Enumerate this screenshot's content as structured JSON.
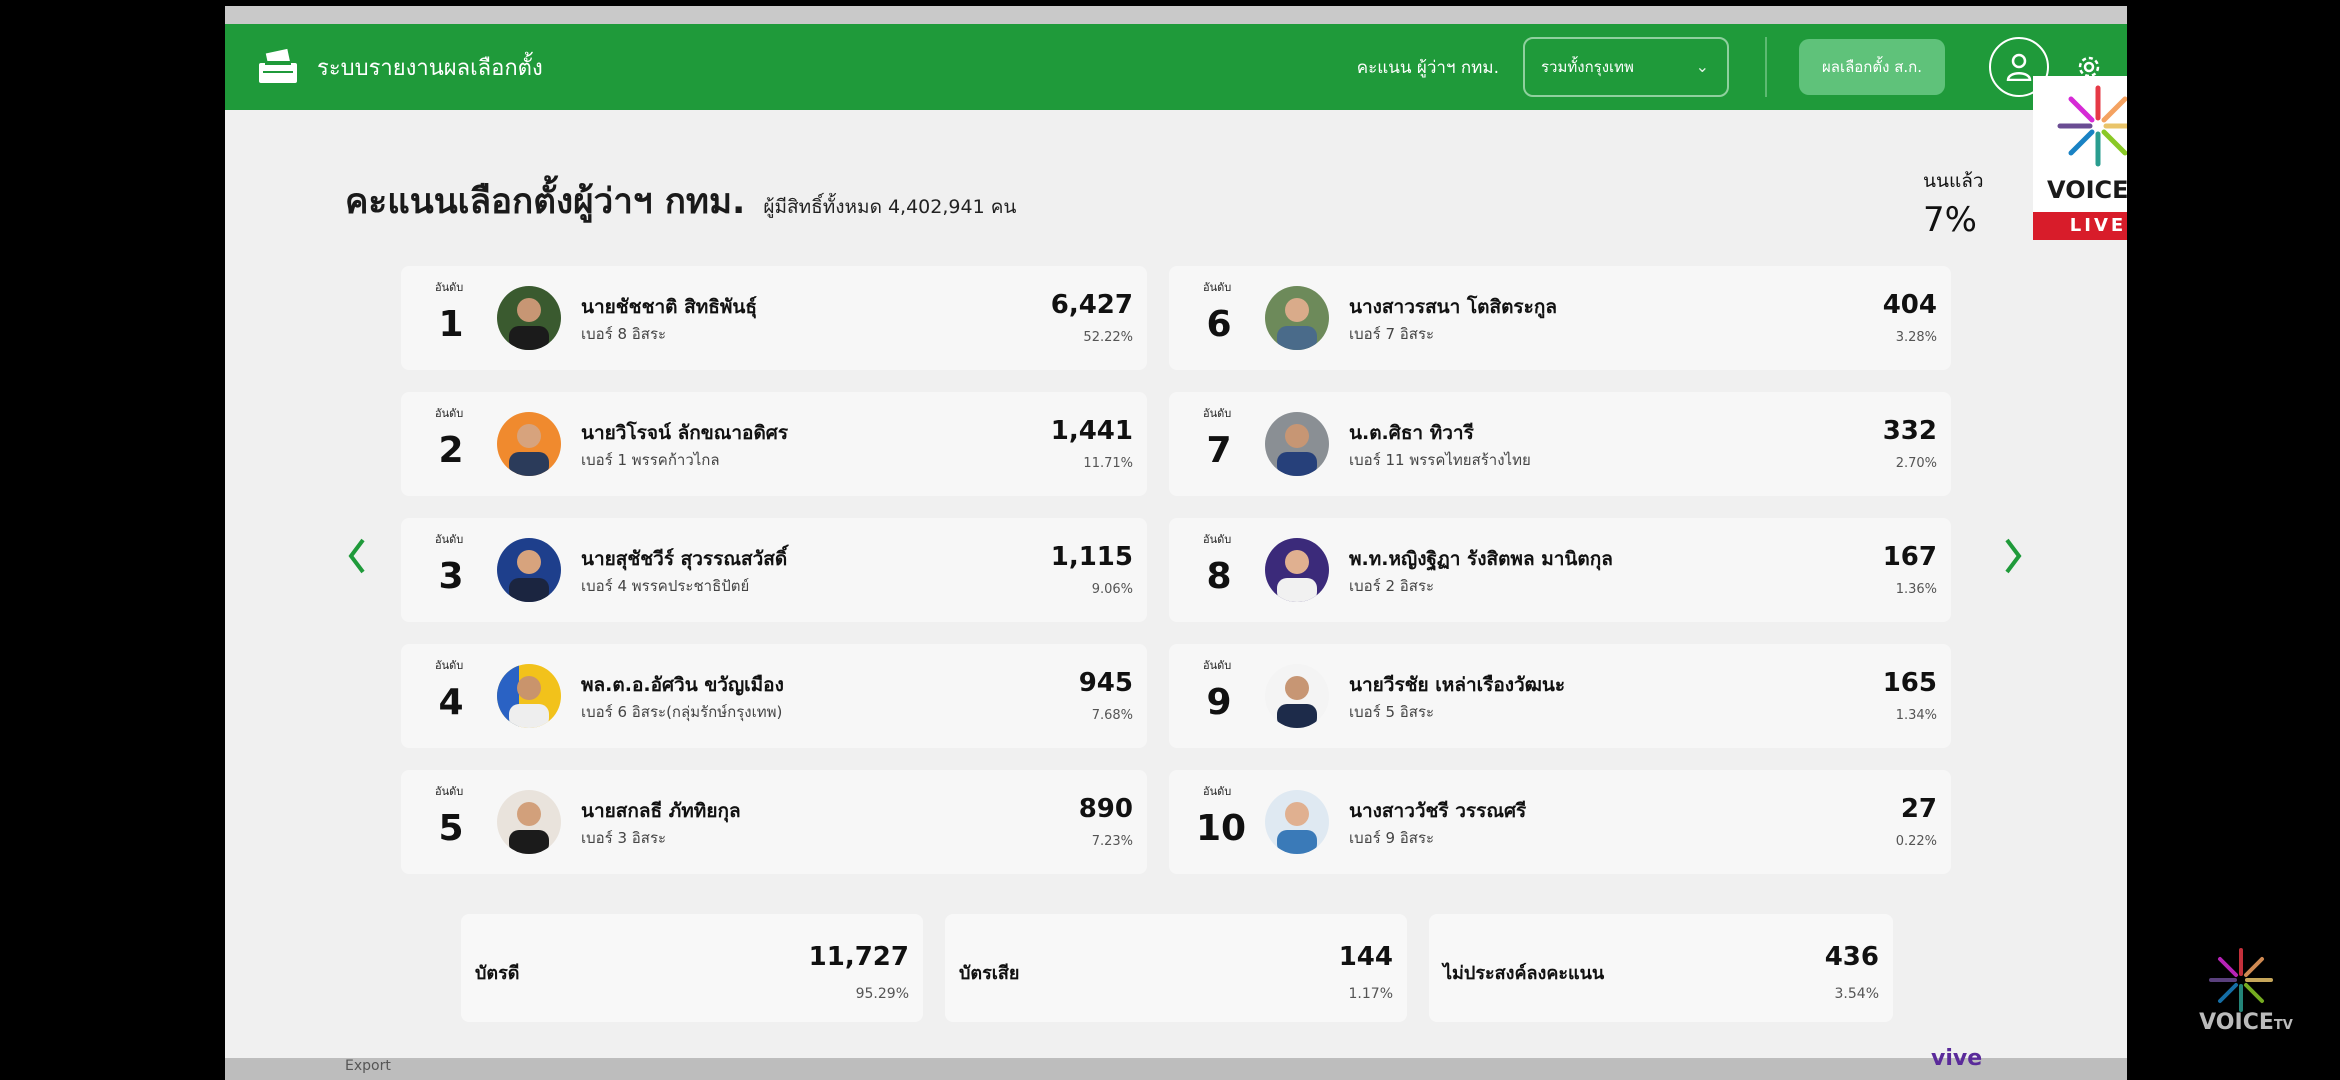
{
  "nav": {
    "brand": "ระบบรายงานผลเลือกตั้ง",
    "score_label": "คะแนน ผู้ว่าฯ กทม.",
    "region_select": "รวมทั้งกรุงเทพ",
    "results_button": "ผลเลือกตั้ง ส.ก."
  },
  "heading": {
    "title": "คะแนนเลือกตั้งผู้ว่าฯ กทม.",
    "eligible": "ผู้มีสิทธิ์ทั้งหมด 4,402,941 คน",
    "counted_label": "นนแล้ว",
    "counted_value": "7%"
  },
  "rank_label": "อันดับ",
  "candidates": [
    {
      "rank": "1",
      "name": "นายชัชชาติ สิทธิพันธุ์",
      "party": "เบอร์ 8 อิสระ",
      "votes": "6,427",
      "pct": "52.22%"
    },
    {
      "rank": "2",
      "name": "นายวิโรจน์ ลักขณาอดิศร",
      "party": "เบอร์ 1 พรรคก้าวไกล",
      "votes": "1,441",
      "pct": "11.71%"
    },
    {
      "rank": "3",
      "name": "นายสุชัชวีร์ สุวรรณสวัสดิ์",
      "party": "เบอร์ 4 พรรคประชาธิปัตย์",
      "votes": "1,115",
      "pct": "9.06%"
    },
    {
      "rank": "4",
      "name": "พล.ต.อ.อัศวิน ขวัญเมือง",
      "party": "เบอร์ 6 อิสระ(กลุ่มรักษ์กรุงเทพ)",
      "votes": "945",
      "pct": "7.68%"
    },
    {
      "rank": "5",
      "name": "นายสกลธี ภัททิยกุล",
      "party": "เบอร์ 3 อิสระ",
      "votes": "890",
      "pct": "7.23%"
    },
    {
      "rank": "6",
      "name": "นางสาวรสนา โตสิตระกูล",
      "party": "เบอร์ 7 อิสระ",
      "votes": "404",
      "pct": "3.28%"
    },
    {
      "rank": "7",
      "name": "น.ต.ศิธา ทิวารี",
      "party": "เบอร์ 11 พรรคไทยสร้างไทย",
      "votes": "332",
      "pct": "2.70%"
    },
    {
      "rank": "8",
      "name": "พ.ท.หญิงฐิฏา รังสิตพล มานิตกุล",
      "party": "เบอร์ 2 อิสระ",
      "votes": "167",
      "pct": "1.36%"
    },
    {
      "rank": "9",
      "name": "นายวีรชัย เหล่าเรืองวัฒนะ",
      "party": "เบอร์ 5 อิสระ",
      "votes": "165",
      "pct": "1.34%"
    },
    {
      "rank": "10",
      "name": "นางสาววัชรี วรรณศรี",
      "party": "เบอร์ 9 อิสระ",
      "votes": "27",
      "pct": "0.22%"
    }
  ],
  "summary": [
    {
      "label": "บัตรดี",
      "value": "11,727",
      "pct": "95.29%"
    },
    {
      "label": "บัตรเสีย",
      "value": "144",
      "pct": "1.17%"
    },
    {
      "label": "ไม่ประสงค์ลงคะแนน",
      "value": "436",
      "pct": "3.54%"
    }
  ],
  "footer": {
    "left": "Export",
    "right": "vive"
  },
  "overlay": {
    "logo_text": "VOICE",
    "logo_suffix": "TV",
    "live": "LIVE"
  },
  "colors": {
    "nav_green": "#1f9a3a",
    "live_red": "#d81c2a"
  }
}
